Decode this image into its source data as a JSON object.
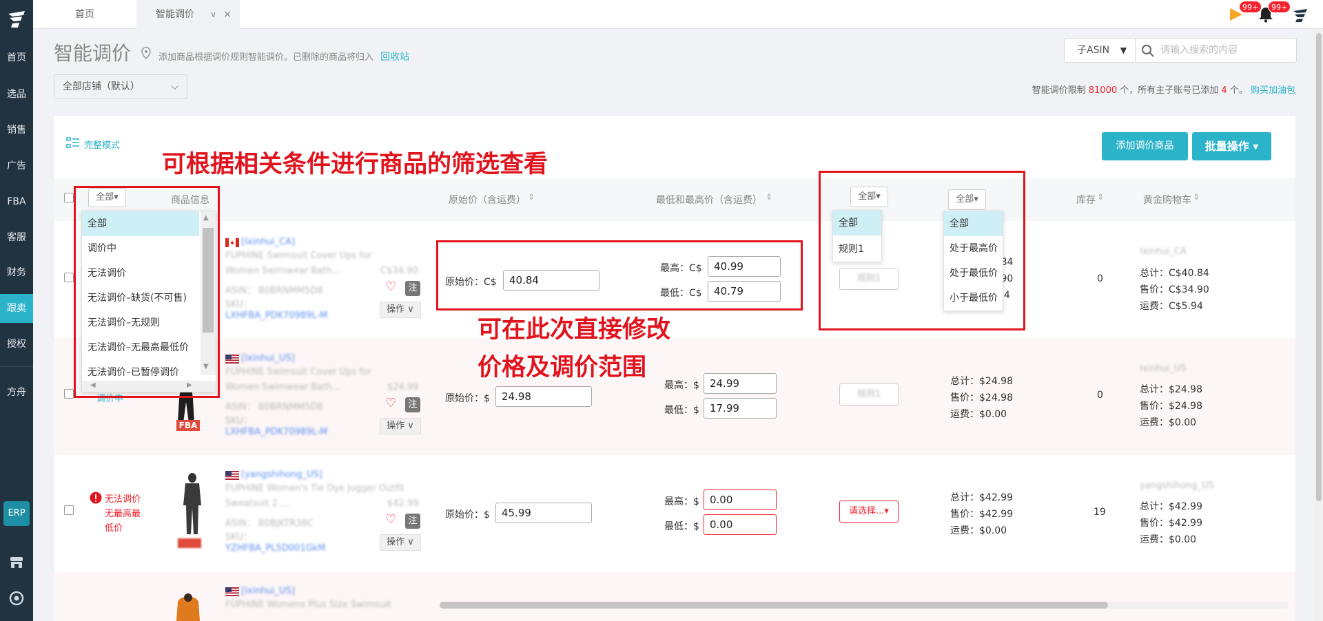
{
  "sidebar": {
    "items": [
      "首页",
      "选品",
      "销售",
      "广告",
      "FBA",
      "客服",
      "财务",
      "跟卖",
      "授权",
      "方舟"
    ],
    "active": "跟卖",
    "erp": "ERP"
  },
  "topbar": {
    "tabs": [
      {
        "label": "首页"
      },
      {
        "label": "智能调价"
      }
    ],
    "close_glyph": "×",
    "arrow_glyph": "∨",
    "flag_badge": "99+",
    "bell_badge": "99+"
  },
  "header": {
    "title": "智能调价",
    "subtitle": "添加商品根据调价规则智能调价。已删除的商品将归入",
    "recycle_link": "回收站",
    "store_select": "全部店铺（默认）",
    "search_type": "子ASIN",
    "search_placeholder": "请输入搜索的内容",
    "limit_prefix": "智能调价限制",
    "limit_value": "81000",
    "limit_mid": "个，所有主子账号已添加",
    "limit_added": "4",
    "limit_suffix": "个。",
    "buy_link": "购买加油包"
  },
  "toolbar": {
    "full_mode": "完整模式",
    "add_button": "添加调价商品",
    "batch_button": "批量操作 ▾"
  },
  "table": {
    "headers": {
      "status_filter": "全部▾",
      "product_info": "商品信息",
      "original_price": "原始价（含运费）",
      "min_max": "最低和最高价（含运费）",
      "rule_filter": "全部▾",
      "compare_filter": "全部▾",
      "stock": "库存",
      "buybox": "黄金购物车"
    },
    "status_dropdown": [
      "全部",
      "调价中",
      "无法调价",
      "无法调价–缺货(不可售)",
      "无法调价–无规则",
      "无法调价–无最高最低价",
      "无法调价–已暂停调价"
    ],
    "rule_dropdown": [
      "全部",
      "规则1"
    ],
    "compare_dropdown": [
      "全部",
      "处于最高价",
      "处于最低价",
      "小于最低价"
    ],
    "rows": [
      {
        "store": "[Ixinhui_CA]",
        "title1": "FUPHINE Swimsuit Cover Ups for",
        "title2": "Women Swimwear Bath...",
        "list_price": "C$34.90",
        "asin": "ASIN： B0BRNMM5D8",
        "sku": "SKU：",
        "sku_val": "LXHFBA_PDK70989L-M",
        "note": "注",
        "op": "操作 ∨",
        "original_label": "原始价：C$",
        "original": "40.84",
        "max_label": "最高：C$",
        "max": "40.99",
        "min_label": "最低：C$",
        "min": "40.79",
        "rule": "规则1",
        "partial1": ".84",
        "partial2": ".90",
        "partial3": "94",
        "stock": "0",
        "bb_store": "Ixinhui_CA",
        "bb_total": "总计：C$40.84",
        "bb_price": "售价：C$34.90",
        "bb_ship": "运费：C$5.94"
      },
      {
        "store": "[Ixinhui_US]",
        "title1": "FUPHINE Swimsuit Cover Ups for",
        "title2": "Women Swimwear Bath...",
        "list_price": "$24.99",
        "asin": "ASIN： B0BRNMM5D8",
        "sku": "SKU：",
        "sku_val": "LXHFBA_PDK70989L-M",
        "note": "注",
        "op": "操作 ∨",
        "status_partial": "调价中",
        "original_label": "原始价：$",
        "original": "24.98",
        "max_label": "最高：$",
        "max": "24.99",
        "min_label": "最低：$",
        "min": "17.99",
        "rule": "规则1",
        "total": "总计：$24.98",
        "price": "售价：$24.98",
        "ship": "运费：$0.00",
        "stock": "0",
        "bb_store": "Ixinhui_US",
        "bb_total": "总计：$24.98",
        "bb_price": "售价：$24.98",
        "bb_ship": "运费：$0.00",
        "fba": "FBA"
      },
      {
        "store": "[yangshihong_US]",
        "title1": "FUPHINE Women's Tie Dye Jogger Outfit",
        "title2": "Sweatsuit 2 ...",
        "list_price": "$42.99",
        "asin": "ASIN： B0BJKTR38C",
        "sku": "SKU：",
        "sku_val": "YZHFBA_PL5D001GkM",
        "note": "注",
        "op": "操作 ∨",
        "status": "无法调价\n无最高最\n低价",
        "status_l1": "无法调价",
        "status_l2": "无最高最",
        "status_l3": "低价",
        "original_label": "原始价：$",
        "original": "45.99",
        "max_label": "最高：$",
        "max": "0.00",
        "min_label": "最低：$",
        "min": "0.00",
        "rule": "请选择...▾",
        "total": "总计：$42.99",
        "price": "售价：$42.99",
        "ship": "运费：$0.00",
        "stock": "19",
        "bb_store": "yangshihong_US",
        "bb_total": "总计：$42.99",
        "bb_price": "售价：$42.99",
        "bb_ship": "运费：$0.00"
      },
      {
        "store": "[Ixinhui_US]",
        "title1": "FUPHINE Womens Plus Size Swimsuit"
      }
    ]
  },
  "annotations": {
    "filter_note": "可根据相关条件进行商品的筛选查看",
    "edit_note1": "可在此次直接修改",
    "edit_note2": "价格及调价范围"
  },
  "colors": {
    "accent": "#2ab3c9",
    "sidebar": "#213240",
    "annotation": "#e1141e"
  }
}
